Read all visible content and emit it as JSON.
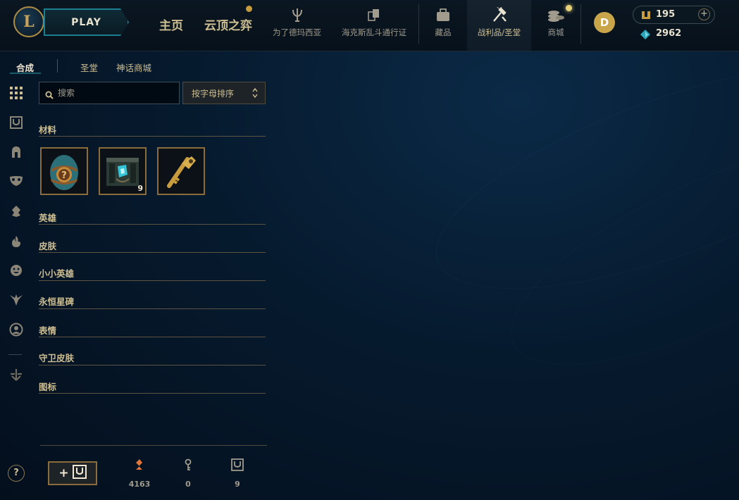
{
  "header": {
    "logo_letter": "L",
    "play_label": "PLAY",
    "nav_home": "主页",
    "nav_tft": "云顶之弈",
    "nav_items": [
      {
        "label": "为了德玛西亚",
        "icon": "trident-icon"
      },
      {
        "label": "海克斯乱斗通行证",
        "icon": "cards-icon"
      },
      {
        "label": "藏品",
        "icon": "backpack-icon"
      },
      {
        "label": "战利品/圣堂",
        "icon": "crafting-hammer-icon"
      },
      {
        "label": "商城",
        "icon": "coins-stack-icon"
      }
    ],
    "avatar_badge_letter": "D",
    "rp_amount": "195",
    "rp_add": "+",
    "blue_essence": "2962",
    "colors": {
      "gold": "#c89b3c",
      "teal": "#1b7f92",
      "essence": "#2aa7bd"
    }
  },
  "subnav": {
    "tabs": [
      "合成",
      "圣堂",
      "神话商城"
    ],
    "active_index": 0
  },
  "rail_icons": [
    "grid-icon",
    "chest-icon",
    "helmet-icon",
    "mask-icon",
    "little-legend-icon",
    "fire-icon",
    "emote-face-icon",
    "ward-icon",
    "profile-icon",
    "arrow-down-icon"
  ],
  "toolbar": {
    "search_placeholder": "搜索",
    "sort_label": "按字母排序"
  },
  "categories": {
    "materials": "材料",
    "champions": "英雄",
    "skins": "皮肤",
    "little_legends": "小小英雄",
    "eternals": "永恒星碑",
    "emotes": "表情",
    "ward_skins": "守卫皮肤",
    "icons": "图标"
  },
  "materials_items": [
    {
      "name": "mystery-egg",
      "count": ""
    },
    {
      "name": "hextech-chest",
      "count": "9"
    },
    {
      "name": "hextech-key",
      "count": ""
    }
  ],
  "bottom": {
    "help_label": "?",
    "add_chest_label": "+",
    "orange_essence": "4163",
    "key_fragments": "0",
    "chests": "9"
  }
}
